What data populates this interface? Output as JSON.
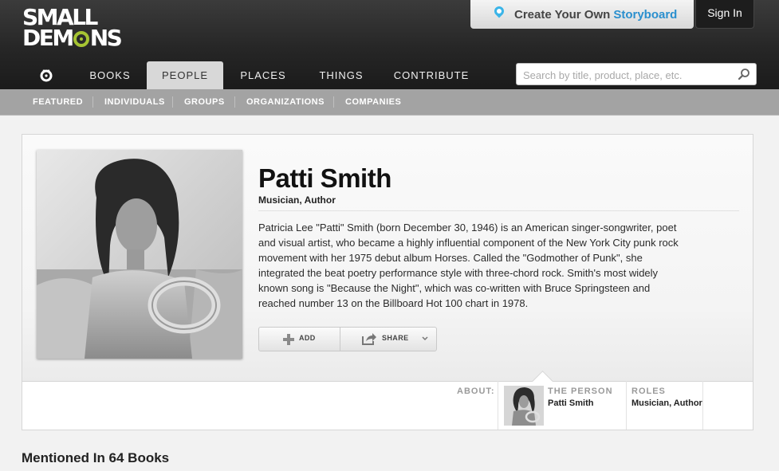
{
  "brand": {
    "logo_line1": "SMALL",
    "logo_line2_a": "DEM",
    "logo_line2_b": "NS"
  },
  "header": {
    "storyboard_prefix": "Create Your Own",
    "storyboard_accent": "Storyboard",
    "signin_label": "Sign In",
    "accent_color": "#2a8fce",
    "logo_accent_color": "#a6c433"
  },
  "nav": {
    "items": [
      {
        "label": "BOOKS"
      },
      {
        "label": "PEOPLE",
        "active": true
      },
      {
        "label": "PLACES"
      },
      {
        "label": "THINGS"
      },
      {
        "label": "CONTRIBUTE"
      }
    ],
    "home_icon": "small-demons-o-icon"
  },
  "search": {
    "placeholder": "Search by title, product, place, etc.",
    "value": ""
  },
  "subnav": {
    "items": [
      {
        "label": "FEATURED"
      },
      {
        "label": "INDIVIDUALS"
      },
      {
        "label": "GROUPS"
      },
      {
        "label": "ORGANIZATIONS"
      },
      {
        "label": "COMPANIES"
      }
    ]
  },
  "person": {
    "name": "Patti Smith",
    "roles": "Musician, Author",
    "bio": "Patricia Lee \"Patti\" Smith (born December 30, 1946) is an American singer-songwriter, poet and visual artist, who became a highly influential component of the New York City punk rock movement with her 1975 debut album Horses. Called the \"Godmother of Punk\", she integrated the beat poetry performance style with three-chord rock. Smith's most widely known song is \"Because the Night\", which was co-written with Bruce Springsteen and reached number 13 on the Billboard Hot 100 chart in 1978."
  },
  "actions": {
    "add_label": "ADD",
    "share_label": "SHARE"
  },
  "about": {
    "label": "ABOUT:",
    "person_head": "THE PERSON",
    "person_value": "Patti Smith",
    "roles_head": "ROLES",
    "roles_value": "Musician, Author"
  },
  "mentioned": {
    "text": "Mentioned In 64 Books"
  }
}
